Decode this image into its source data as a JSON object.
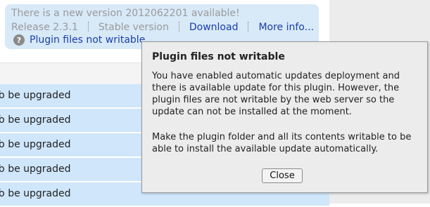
{
  "update_box": {
    "title": "There is a new version 2012062201 available!",
    "release": "Release 2.3.1",
    "stability": "Stable version",
    "download_label": "Download",
    "more_info_label": "More info...",
    "warning_label": "Plugin files not writable",
    "help_icon": "?"
  },
  "rows": [
    {
      "status": "To be upgraded"
    },
    {
      "status": "To be upgraded"
    },
    {
      "status": "To be upgraded"
    },
    {
      "status": "To be upgraded"
    },
    {
      "status": "To be upgraded"
    }
  ],
  "popup": {
    "title": "Plugin files not writable",
    "paragraph1": "You have enabled automatic updates deployment and there is available update for this plugin. However, the plugin files are not writable by the web server so the update can not be installed at the moment.",
    "paragraph2": "Make the plugin folder and all its contents writable to be able to install the available update automatically.",
    "close_label": "Close"
  },
  "colors": {
    "update_box_bg": "#d8e9f8",
    "row_bg": "#cfe6fb",
    "link": "#1a41a8",
    "popup_bg": "#ececec"
  }
}
